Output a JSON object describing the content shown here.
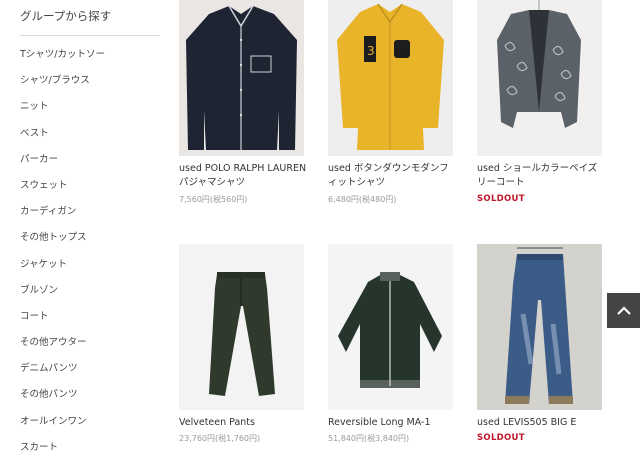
{
  "sidebar": {
    "title": "グループから探す",
    "items": [
      {
        "label": "Tシャツ/カットソー"
      },
      {
        "label": "シャツ/ブラウス"
      },
      {
        "label": "ニット"
      },
      {
        "label": "ベスト"
      },
      {
        "label": "パーカー"
      },
      {
        "label": "スウェット"
      },
      {
        "label": "カーディガン"
      },
      {
        "label": "その他トップス"
      },
      {
        "label": "ジャケット"
      },
      {
        "label": "ブルゾン"
      },
      {
        "label": "コート"
      },
      {
        "label": "その他アウター"
      },
      {
        "label": "デニムパンツ"
      },
      {
        "label": "その他パンツ"
      },
      {
        "label": "オールインワン"
      },
      {
        "label": "スカート"
      }
    ]
  },
  "products": [
    {
      "name_line1": "used POLO RALPH LAUREN",
      "name_line2": "パジャマシャツ",
      "price": "7,560円(税560円)",
      "status": ""
    },
    {
      "name_line1": "used ボタンダウンモダンフ",
      "name_line2": "ィットシャツ",
      "price": "6,480円(税480円)",
      "status": ""
    },
    {
      "name_line1": "used ショールカラーペイズ",
      "name_line2": "リーコート",
      "price": "",
      "status": "SOLDOUT"
    },
    {
      "name_line1": "Velveteen Pants",
      "name_line2": "",
      "price": "23,760円(税1,760円)",
      "status": ""
    },
    {
      "name_line1": "Reversible Long MA-1",
      "name_line2": "",
      "price": "51,840円(税3,840円)",
      "status": ""
    },
    {
      "name_line1": "used LEVIS505 BIG E",
      "name_line2": "",
      "price": "",
      "status": "SOLDOUT"
    }
  ],
  "back_to_top": {
    "icon": "chevron-up-icon"
  },
  "colors": {
    "soldout": "#c0192b",
    "back_to_top_bg": "#444444"
  }
}
